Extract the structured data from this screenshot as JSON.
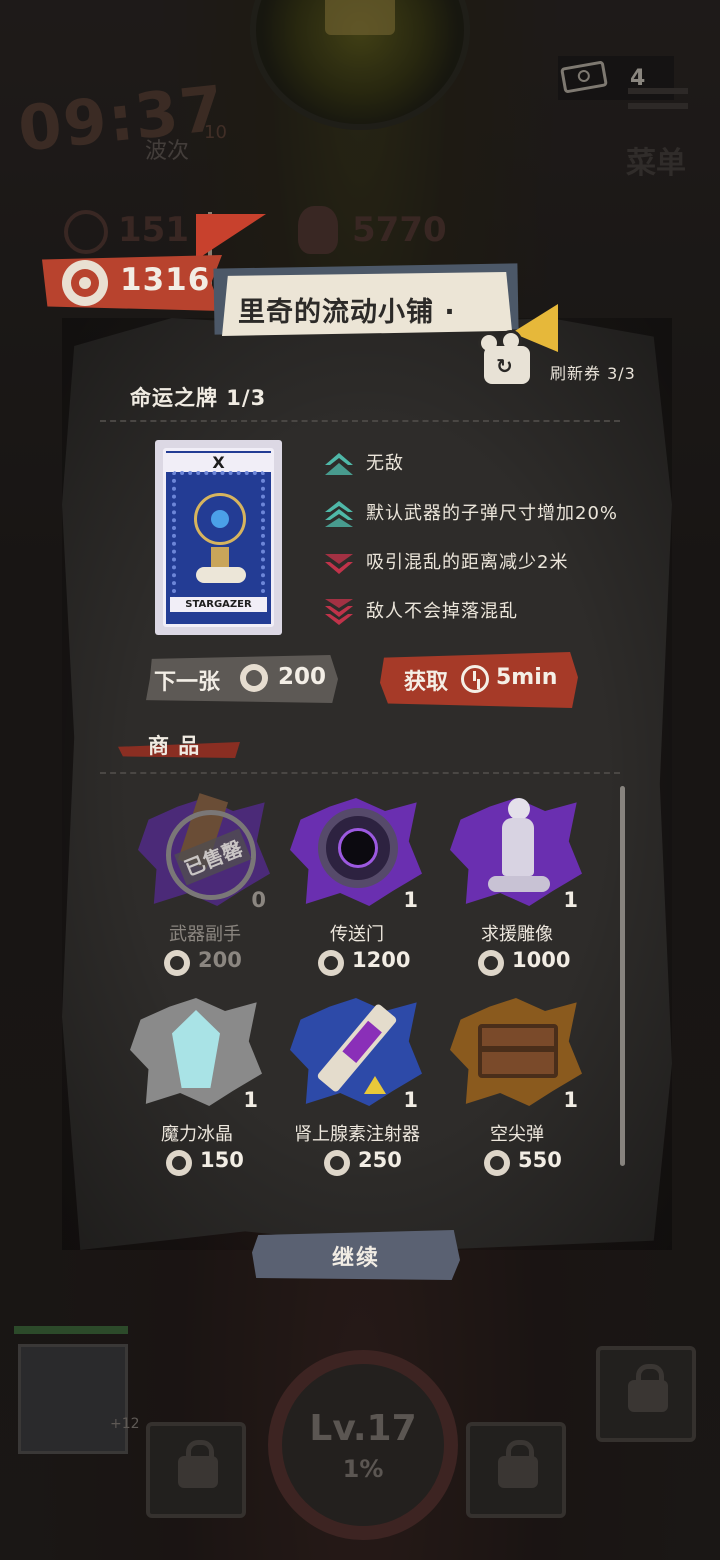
{
  "hud": {
    "timer": "09:37",
    "wave_label": "波次",
    "wave_number": "10",
    "ticket_count": "4",
    "menu_label": "菜单",
    "ghost_coins": "151",
    "ghost_kills": "5770",
    "coins": "1316",
    "level": "Lv.17",
    "level_progress": "1%",
    "weapon_bonus": "+12"
  },
  "shop": {
    "title": "里奇的流动小铺 ·",
    "refresh_label": "刷新券 3/3",
    "fate_section": "命运之牌 1/3",
    "goods_section": "商 品",
    "continue_label": "继续"
  },
  "fate_card": {
    "roman": "X",
    "name": "STARGAZER",
    "effects": [
      {
        "text": "无敌",
        "kind": "up-single"
      },
      {
        "text": "默认武器的子弹尺寸增加20%",
        "kind": "up-double"
      },
      {
        "text": "吸引混乱的距离减少2米",
        "kind": "down-single"
      },
      {
        "text": "敌人不会掉落混乱",
        "kind": "down-double"
      }
    ],
    "next_label": "下一张",
    "next_cost": "200",
    "get_label": "获取",
    "get_time": "5min"
  },
  "items": [
    {
      "name": "武器副手",
      "count": "0",
      "price": "200",
      "sold": true,
      "sold_stamp": "已售罄"
    },
    {
      "name": "传送门",
      "count": "1",
      "price": "1200",
      "sold": false
    },
    {
      "name": "求援雕像",
      "count": "1",
      "price": "1000",
      "sold": false
    },
    {
      "name": "魔力冰晶",
      "count": "1",
      "price": "150",
      "sold": false
    },
    {
      "name": "肾上腺素注射器",
      "count": "1",
      "price": "250",
      "sold": false
    },
    {
      "name": "空尖弹",
      "count": "1",
      "price": "550",
      "sold": false
    }
  ],
  "colors": {
    "accent_red": "#b8432e",
    "buff_teal": "#4fb8a8",
    "debuff_crimson": "#c0334a",
    "panel": "#2e2c2a",
    "continue_button": "#5a6172"
  }
}
